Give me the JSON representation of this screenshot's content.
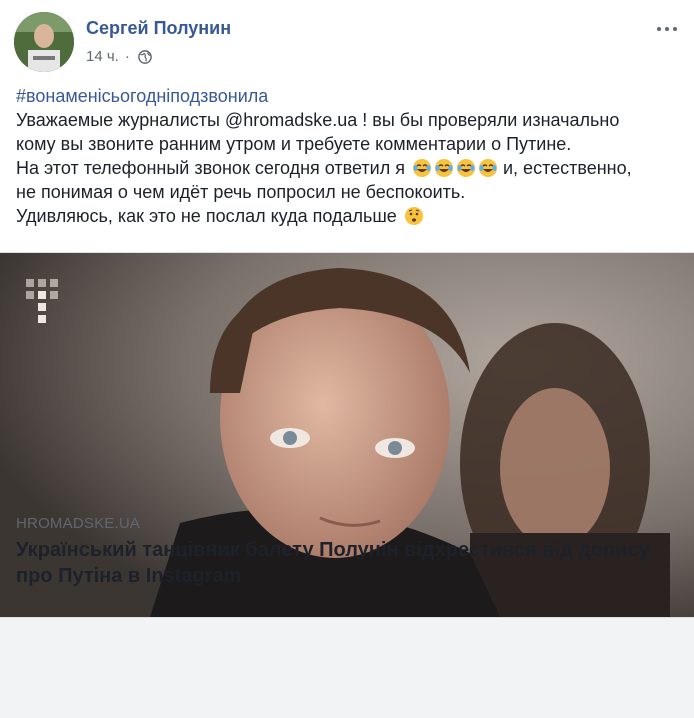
{
  "post": {
    "author": {
      "name": "Сергей Полунин",
      "avatar_icon": "profile-photo"
    },
    "timestamp": "14 ч.",
    "privacy_icon": "globe-icon",
    "more_icon": "more-horizontal-icon",
    "hashtag": "#вонаменісьогодніподзвонила",
    "lines": {
      "l1": "Уважаемые журналисты @hromadske.ua ! вы бы проверяли изначально",
      "l2": "кому вы звоните ранним утром и требуете комментарии о Путине.",
      "l3a": "На этот телефонный звонок сегодня ответил я ",
      "l3b": " и, естественно,",
      "l4": "не понимая о чем идёт речь попросил не беспокоить.",
      "l5": "Удивляюсь, как это не послал куда подальше "
    },
    "emojis": [
      "tears-of-joy-emoji",
      "tears-of-joy-emoji",
      "tears-of-joy-emoji",
      "tears-of-joy-emoji",
      "surprised-face-emoji"
    ]
  },
  "link_card": {
    "domain": "HROMADSKE.UA",
    "title": "Український танцівник балету Полунін відхрестився від допису про Путіна в Instagram",
    "image_logo_icon": "hromadske-logo-icon"
  }
}
